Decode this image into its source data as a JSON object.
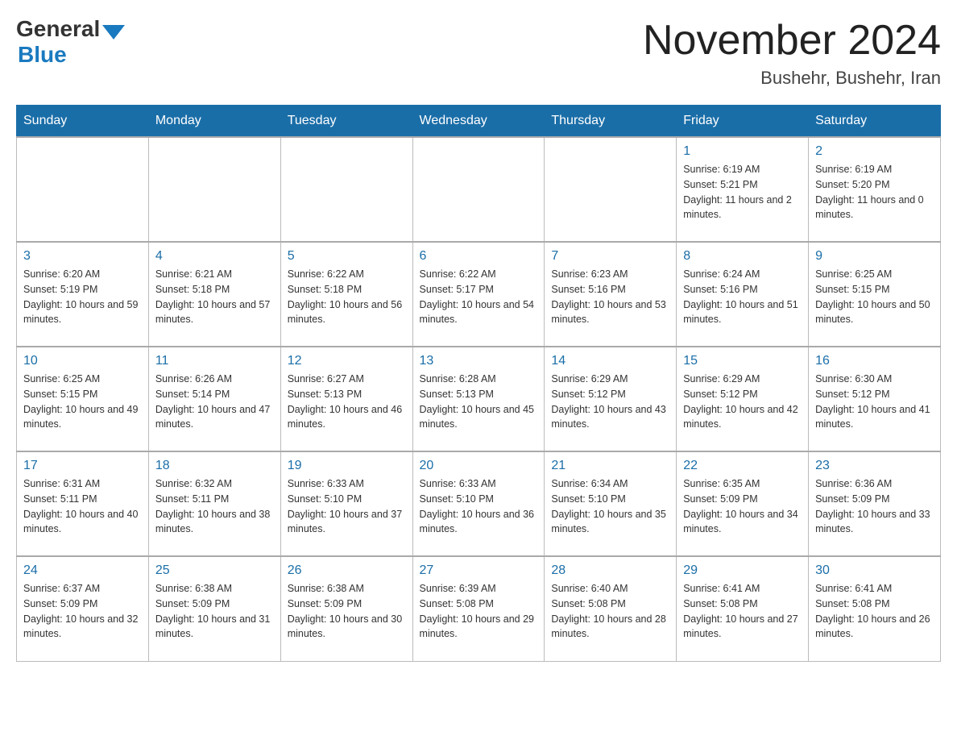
{
  "header": {
    "logo_general": "General",
    "logo_blue": "Blue",
    "month_year": "November 2024",
    "location": "Bushehr, Bushehr, Iran"
  },
  "weekdays": [
    "Sunday",
    "Monday",
    "Tuesday",
    "Wednesday",
    "Thursday",
    "Friday",
    "Saturday"
  ],
  "weeks": [
    [
      {
        "day": "",
        "sunrise": "",
        "sunset": "",
        "daylight": ""
      },
      {
        "day": "",
        "sunrise": "",
        "sunset": "",
        "daylight": ""
      },
      {
        "day": "",
        "sunrise": "",
        "sunset": "",
        "daylight": ""
      },
      {
        "day": "",
        "sunrise": "",
        "sunset": "",
        "daylight": ""
      },
      {
        "day": "",
        "sunrise": "",
        "sunset": "",
        "daylight": ""
      },
      {
        "day": "1",
        "sunrise": "Sunrise: 6:19 AM",
        "sunset": "Sunset: 5:21 PM",
        "daylight": "Daylight: 11 hours and 2 minutes."
      },
      {
        "day": "2",
        "sunrise": "Sunrise: 6:19 AM",
        "sunset": "Sunset: 5:20 PM",
        "daylight": "Daylight: 11 hours and 0 minutes."
      }
    ],
    [
      {
        "day": "3",
        "sunrise": "Sunrise: 6:20 AM",
        "sunset": "Sunset: 5:19 PM",
        "daylight": "Daylight: 10 hours and 59 minutes."
      },
      {
        "day": "4",
        "sunrise": "Sunrise: 6:21 AM",
        "sunset": "Sunset: 5:18 PM",
        "daylight": "Daylight: 10 hours and 57 minutes."
      },
      {
        "day": "5",
        "sunrise": "Sunrise: 6:22 AM",
        "sunset": "Sunset: 5:18 PM",
        "daylight": "Daylight: 10 hours and 56 minutes."
      },
      {
        "day": "6",
        "sunrise": "Sunrise: 6:22 AM",
        "sunset": "Sunset: 5:17 PM",
        "daylight": "Daylight: 10 hours and 54 minutes."
      },
      {
        "day": "7",
        "sunrise": "Sunrise: 6:23 AM",
        "sunset": "Sunset: 5:16 PM",
        "daylight": "Daylight: 10 hours and 53 minutes."
      },
      {
        "day": "8",
        "sunrise": "Sunrise: 6:24 AM",
        "sunset": "Sunset: 5:16 PM",
        "daylight": "Daylight: 10 hours and 51 minutes."
      },
      {
        "day": "9",
        "sunrise": "Sunrise: 6:25 AM",
        "sunset": "Sunset: 5:15 PM",
        "daylight": "Daylight: 10 hours and 50 minutes."
      }
    ],
    [
      {
        "day": "10",
        "sunrise": "Sunrise: 6:25 AM",
        "sunset": "Sunset: 5:15 PM",
        "daylight": "Daylight: 10 hours and 49 minutes."
      },
      {
        "day": "11",
        "sunrise": "Sunrise: 6:26 AM",
        "sunset": "Sunset: 5:14 PM",
        "daylight": "Daylight: 10 hours and 47 minutes."
      },
      {
        "day": "12",
        "sunrise": "Sunrise: 6:27 AM",
        "sunset": "Sunset: 5:13 PM",
        "daylight": "Daylight: 10 hours and 46 minutes."
      },
      {
        "day": "13",
        "sunrise": "Sunrise: 6:28 AM",
        "sunset": "Sunset: 5:13 PM",
        "daylight": "Daylight: 10 hours and 45 minutes."
      },
      {
        "day": "14",
        "sunrise": "Sunrise: 6:29 AM",
        "sunset": "Sunset: 5:12 PM",
        "daylight": "Daylight: 10 hours and 43 minutes."
      },
      {
        "day": "15",
        "sunrise": "Sunrise: 6:29 AM",
        "sunset": "Sunset: 5:12 PM",
        "daylight": "Daylight: 10 hours and 42 minutes."
      },
      {
        "day": "16",
        "sunrise": "Sunrise: 6:30 AM",
        "sunset": "Sunset: 5:12 PM",
        "daylight": "Daylight: 10 hours and 41 minutes."
      }
    ],
    [
      {
        "day": "17",
        "sunrise": "Sunrise: 6:31 AM",
        "sunset": "Sunset: 5:11 PM",
        "daylight": "Daylight: 10 hours and 40 minutes."
      },
      {
        "day": "18",
        "sunrise": "Sunrise: 6:32 AM",
        "sunset": "Sunset: 5:11 PM",
        "daylight": "Daylight: 10 hours and 38 minutes."
      },
      {
        "day": "19",
        "sunrise": "Sunrise: 6:33 AM",
        "sunset": "Sunset: 5:10 PM",
        "daylight": "Daylight: 10 hours and 37 minutes."
      },
      {
        "day": "20",
        "sunrise": "Sunrise: 6:33 AM",
        "sunset": "Sunset: 5:10 PM",
        "daylight": "Daylight: 10 hours and 36 minutes."
      },
      {
        "day": "21",
        "sunrise": "Sunrise: 6:34 AM",
        "sunset": "Sunset: 5:10 PM",
        "daylight": "Daylight: 10 hours and 35 minutes."
      },
      {
        "day": "22",
        "sunrise": "Sunrise: 6:35 AM",
        "sunset": "Sunset: 5:09 PM",
        "daylight": "Daylight: 10 hours and 34 minutes."
      },
      {
        "day": "23",
        "sunrise": "Sunrise: 6:36 AM",
        "sunset": "Sunset: 5:09 PM",
        "daylight": "Daylight: 10 hours and 33 minutes."
      }
    ],
    [
      {
        "day": "24",
        "sunrise": "Sunrise: 6:37 AM",
        "sunset": "Sunset: 5:09 PM",
        "daylight": "Daylight: 10 hours and 32 minutes."
      },
      {
        "day": "25",
        "sunrise": "Sunrise: 6:38 AM",
        "sunset": "Sunset: 5:09 PM",
        "daylight": "Daylight: 10 hours and 31 minutes."
      },
      {
        "day": "26",
        "sunrise": "Sunrise: 6:38 AM",
        "sunset": "Sunset: 5:09 PM",
        "daylight": "Daylight: 10 hours and 30 minutes."
      },
      {
        "day": "27",
        "sunrise": "Sunrise: 6:39 AM",
        "sunset": "Sunset: 5:08 PM",
        "daylight": "Daylight: 10 hours and 29 minutes."
      },
      {
        "day": "28",
        "sunrise": "Sunrise: 6:40 AM",
        "sunset": "Sunset: 5:08 PM",
        "daylight": "Daylight: 10 hours and 28 minutes."
      },
      {
        "day": "29",
        "sunrise": "Sunrise: 6:41 AM",
        "sunset": "Sunset: 5:08 PM",
        "daylight": "Daylight: 10 hours and 27 minutes."
      },
      {
        "day": "30",
        "sunrise": "Sunrise: 6:41 AM",
        "sunset": "Sunset: 5:08 PM",
        "daylight": "Daylight: 10 hours and 26 minutes."
      }
    ]
  ]
}
